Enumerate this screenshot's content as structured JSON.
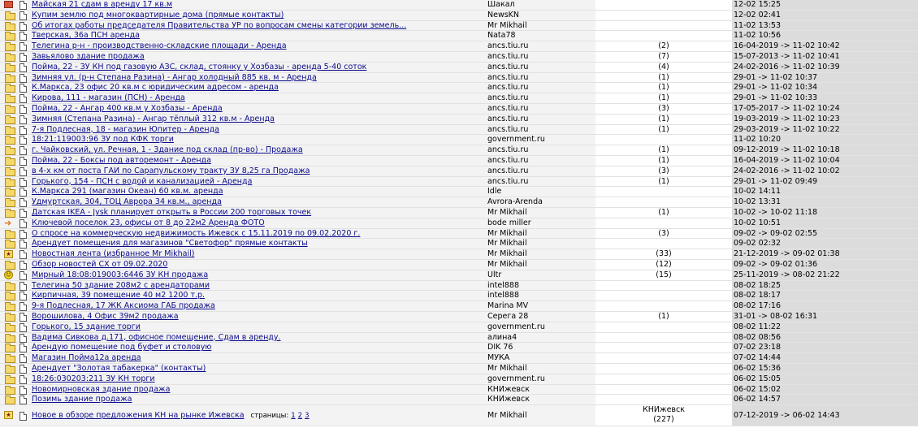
{
  "topics": [
    {
      "icon": "mail",
      "title": "Майская 21 сдам в аренду 17 кв.м",
      "author": "Шакал",
      "replies": "",
      "last": "12-02 15:25"
    },
    {
      "icon": "folder",
      "title": "Купим землю под многоквартирные дома (прямые контакты)",
      "author": "NewsKN",
      "replies": "",
      "last": "12-02 02:41"
    },
    {
      "icon": "folder",
      "title": "Об итогах работы председателя Правительства УР по вопросам смены категории земель...",
      "author": "Mr Mikhail",
      "replies": "",
      "last": "11-02 13:53"
    },
    {
      "icon": "folder",
      "title": "Тверская, 36а ПСН аренда",
      "author": "Nata78",
      "replies": "",
      "last": "11-02 10:56"
    },
    {
      "icon": "folder",
      "title": "Телегина р-н - производственно-складские площади - Аренда",
      "author": "ancs.tiu.ru",
      "replies": "(2)",
      "last": "16-04-2019 -> 11-02 10:42"
    },
    {
      "icon": "folder",
      "title": "Завьялово здание продажа",
      "author": "ancs.tiu.ru",
      "replies": "(7)",
      "last": "15-07-2013 -> 11-02 10:41"
    },
    {
      "icon": "folder",
      "title": "Пойма, 22 - ЗУ КН под газовую АЗС, склад, стоянку у Хозбазы - аренда 5-40 соток",
      "author": "ancs.tiu.ru",
      "replies": "(4)",
      "last": "24-02-2016 -> 11-02 10:39"
    },
    {
      "icon": "folder",
      "title": "Зимняя ул. (р-н Степана Разина) - Ангар холодный 885 кв. м - Аренда",
      "author": "ancs.tiu.ru",
      "replies": "(1)",
      "last": "29-01 -> 11-02 10:37"
    },
    {
      "icon": "folder",
      "title": "К.Маркса, 23 офис 20 кв.м с юридическим адресом - аренда",
      "author": "ancs.tiu.ru",
      "replies": "(1)",
      "last": "29-01 -> 11-02 10:34"
    },
    {
      "icon": "folder",
      "title": "Кирова, 111 - магазин (ПСН) - Аренда",
      "author": "ancs.tiu.ru",
      "replies": "(1)",
      "last": "29-01 -> 11-02 10:33"
    },
    {
      "icon": "folder",
      "title": "Пойма, 22 - Ангар 400 кв.м у Хозбазы - Аренда",
      "author": "ancs.tiu.ru",
      "replies": "(3)",
      "last": "17-05-2017 -> 11-02 10:24"
    },
    {
      "icon": "folder",
      "title": "Зимняя (Степана Разина) - Ангар тёплый 312 кв.м - Аренда",
      "author": "ancs.tiu.ru",
      "replies": "(1)",
      "last": "19-03-2019 -> 11-02 10:23"
    },
    {
      "icon": "folder",
      "title": "7-я Подлесная, 18 - магазин Юпитер - Аренда",
      "author": "ancs.tiu.ru",
      "replies": "(1)",
      "last": "29-03-2019 -> 11-02 10:22"
    },
    {
      "icon": "folder",
      "title": "18:21:119003:96 ЗУ под КФК торги",
      "author": "government.ru",
      "replies": "",
      "last": "11-02 10:20"
    },
    {
      "icon": "folder",
      "title": "г. Чайковский, ул. Речная, 1 - Здание под склад (пр-во) - Продажа",
      "author": "ancs.tiu.ru",
      "replies": "(1)",
      "last": "09-12-2019 -> 11-02 10:18"
    },
    {
      "icon": "folder",
      "title": "Пойма, 22 - Боксы под авторемонт - Аренда",
      "author": "ancs.tiu.ru",
      "replies": "(1)",
      "last": "16-04-2019 -> 11-02 10:04"
    },
    {
      "icon": "folder",
      "title": "в 4-х км от поста ГАИ по Сарапульскому тракту ЗУ 8,25 га Продажа",
      "author": "ancs.tiu.ru",
      "replies": "(3)",
      "last": "24-02-2016 -> 11-02 10:02"
    },
    {
      "icon": "folder",
      "title": "Горького, 154 - ПСН с водой и канализацией - Аренда",
      "author": "ancs.tiu.ru",
      "replies": "(1)",
      "last": "29-01 -> 11-02 09:49"
    },
    {
      "icon": "folder",
      "title": "К.Маркса 291 (магазин Океан) 60 кв.м. аренда",
      "author": "Idle",
      "replies": "",
      "last": "10-02 14:11"
    },
    {
      "icon": "folder",
      "title": "Удмуртская, 304, ТОЦ Аврора 34 кв.м., аренда",
      "author": "Avrora-Arenda",
      "replies": "",
      "last": "10-02 13:31"
    },
    {
      "icon": "folder",
      "title": "Датская IKEA - Jysk планирует открыть в России 200 торговых точек",
      "author": "Mr Mikhail",
      "replies": "(1)",
      "last": "10-02 -> 10-02 11:18"
    },
    {
      "icon": "arrow",
      "title": "Ключевой поселок 23, офисы от 8 до 22м2 Аренда ФОТО",
      "author": "bode miller",
      "replies": "",
      "last": "10-02 10:51"
    },
    {
      "icon": "folder",
      "title": "О спросе на коммерческую недвижимость Ижевск с 15.11.2019 по 09.02.2020 г.",
      "author": "Mr Mikhail",
      "replies": "(3)",
      "last": "09-02 -> 09-02 02:55"
    },
    {
      "icon": "folder",
      "title": "Арендует помещения для магазинов \"Светофор\" прямые контакты",
      "author": "Mr Mikhail",
      "replies": "",
      "last": "09-02 02:32"
    },
    {
      "icon": "hot",
      "title": "Новостная лента (избранное Mr Mikhail)",
      "author": "Mr Mikhail",
      "replies": "(33)",
      "last": "21-12-2019 -> 09-02 01:38"
    },
    {
      "icon": "folder",
      "title": "Обзор новостей СХ от 09.02.2020",
      "author": "Mr Mikhail",
      "replies": "(12)",
      "last": "09-02 -> 09-02 01:36"
    },
    {
      "icon": "smiley",
      "title": "Мирный 18:08:019003:6446 ЗУ КН продажа",
      "author": "Ultr",
      "replies": "(15)",
      "last": "25-11-2019 -> 08-02 21:22"
    },
    {
      "icon": "folder",
      "title": "Телегина 50 здание 208м2 с арендаторами",
      "author": "intel888",
      "replies": "",
      "last": "08-02 18:25"
    },
    {
      "icon": "folder",
      "title": "Кирпичная, 39 помещение 40 м2 1200 т.р.",
      "author": "intel888",
      "replies": "",
      "last": "08-02 18:17"
    },
    {
      "icon": "folder",
      "title": "9-я Подлесная, 17 ЖК Аксиома ГАБ продажа",
      "author": "Marina MV",
      "replies": "",
      "last": "08-02 17:16"
    },
    {
      "icon": "folder",
      "title": "Ворошилова, 4 Офис 39м2 продажа",
      "author": "Серега 28",
      "replies": "(1)",
      "last": "31-01 -> 08-02 16:31"
    },
    {
      "icon": "folder",
      "title": "Горького, 15 здание торги",
      "author": "government.ru",
      "replies": "",
      "last": "08-02 11:22"
    },
    {
      "icon": "folder",
      "title": "Вадима Сивкова д.171, офисное помещение, Сдам в аренду.",
      "author": "алина4",
      "replies": "",
      "last": "08-02 08:56"
    },
    {
      "icon": "folder",
      "title": "Арендую помещение под буфет и столовую",
      "author": "DIK 76",
      "replies": "",
      "last": "07-02 23:18"
    },
    {
      "icon": "folder",
      "title": "Магазин Пойма12а аренда",
      "author": "МУКА",
      "replies": "",
      "last": "07-02 14:44"
    },
    {
      "icon": "folder",
      "title": "Арендует \"Золотая табакерка\" (контакты)",
      "author": "Mr Mikhail",
      "replies": "",
      "last": "06-02 15:36"
    },
    {
      "icon": "folder",
      "title": "18:26:030203:211 ЗУ КН торги",
      "author": "government.ru",
      "replies": "",
      "last": "06-02 15:05"
    },
    {
      "icon": "folder",
      "title": "Новомирновская здание продажа",
      "author": "КНИжевск",
      "replies": "",
      "last": "06-02 15:02"
    },
    {
      "icon": "folder",
      "title": "Позимь здание продажа",
      "author": "КНИжевск",
      "replies": "",
      "last": "06-02 14:57"
    }
  ],
  "last_topic": {
    "icon": "hot",
    "title": "Новое в обзоре предложения КН на рынке Ижевска",
    "pages_label": "страницы:",
    "pages": [
      "1",
      "2",
      "3"
    ],
    "author": "Mr Mikhail",
    "replies_author": "КНИжевск",
    "replies": "(227)",
    "last": "07-12-2019 -> 06-02 14:43"
  }
}
